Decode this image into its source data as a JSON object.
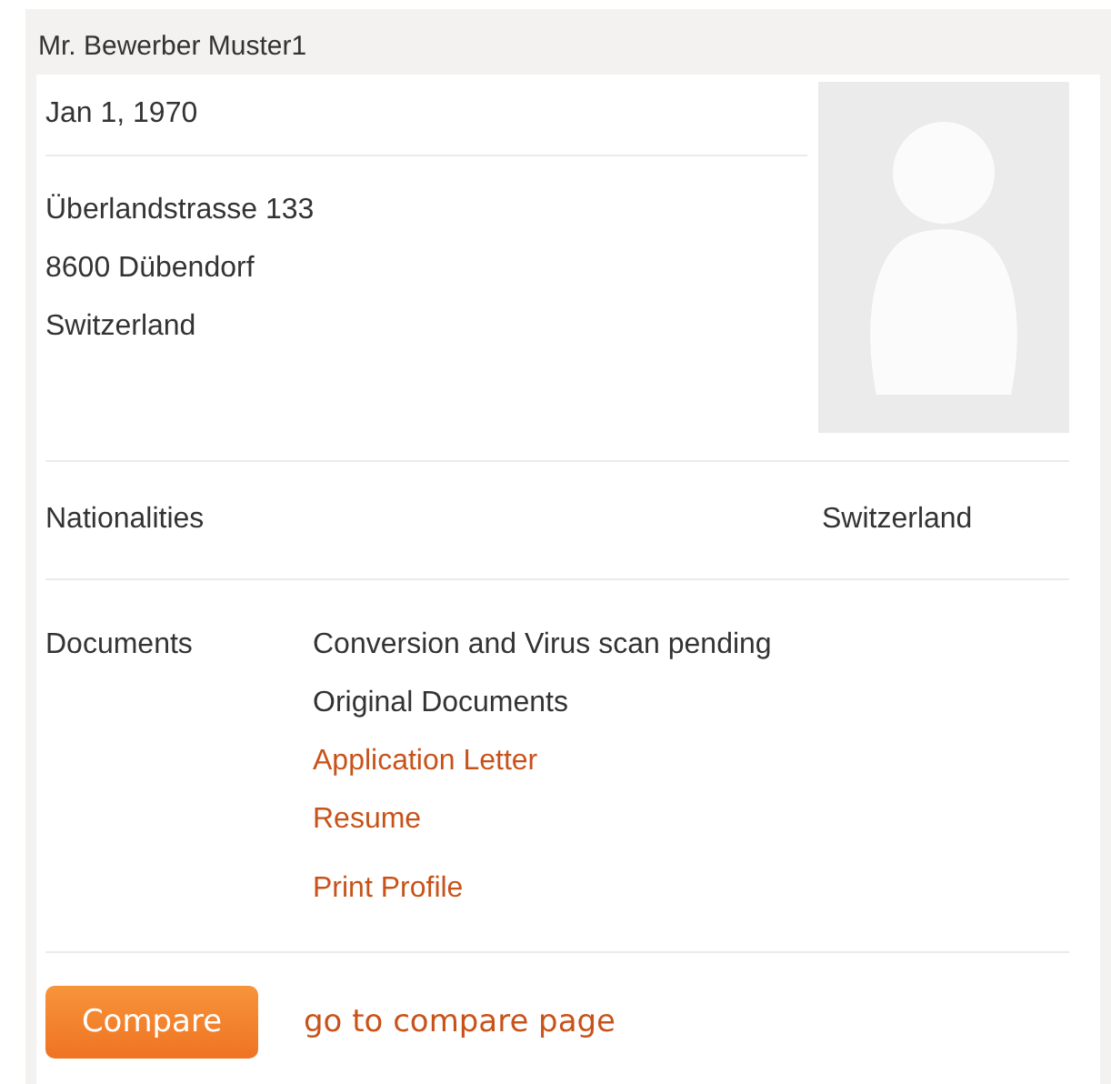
{
  "header": {
    "title": "Mr. Bewerber Muster1"
  },
  "profile": {
    "birth_date": "Jan 1, 1970",
    "address": [
      "Überlandstrasse 133",
      "8600 Dübendorf",
      "Switzerland"
    ],
    "photo": {
      "kind": "avatar-placeholder"
    }
  },
  "nationalities": {
    "label": "Nationalities",
    "value": "Switzerland"
  },
  "documents": {
    "label": "Documents",
    "items": [
      {
        "kind": "text",
        "text": "Conversion and Virus scan pending"
      },
      {
        "kind": "text",
        "text": "Original Documents"
      },
      {
        "kind": "link",
        "text": "Application Letter"
      },
      {
        "kind": "link",
        "text": "Resume"
      },
      {
        "kind": "action",
        "text": "Print Profile"
      }
    ]
  },
  "footer": {
    "button": "Compare",
    "link": "go to compare page"
  }
}
